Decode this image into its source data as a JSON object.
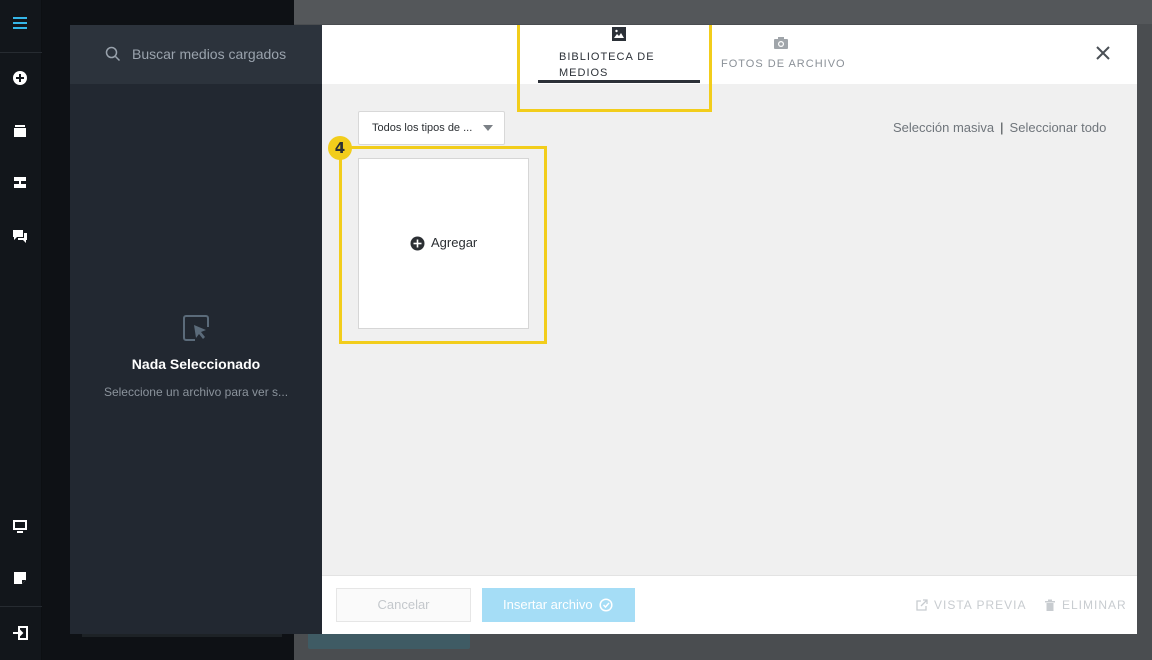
{
  "search": {
    "placeholder": "Buscar medios cargados"
  },
  "sidebar": {
    "empty_title": "Nada Seleccionado",
    "empty_subtitle": "Seleccione un archivo para ver s..."
  },
  "tabs": [
    {
      "label": "BIBLIOTECA DE MEDIOS",
      "icon": "image-icon",
      "active": true
    },
    {
      "label": "FOTOS DE ARCHIVO",
      "icon": "camera-icon",
      "active": false
    }
  ],
  "filter": {
    "selected": "Todos los tipos de ..."
  },
  "bulk": {
    "mass_select": "Selección masiva",
    "select_all": "Seleccionar todo"
  },
  "add_card": {
    "label": "Agregar"
  },
  "annotation": {
    "step": "4"
  },
  "footer": {
    "cancel": "Cancelar",
    "insert": "Insertar archivo",
    "preview": "VISTA PREVIA",
    "delete": "ELIMINAR"
  },
  "colors": {
    "highlight": "#f2cd1b",
    "rail_accent": "#35b6e8",
    "insert_button": "#a5ddf6",
    "sidebar_bg": "#222831"
  }
}
